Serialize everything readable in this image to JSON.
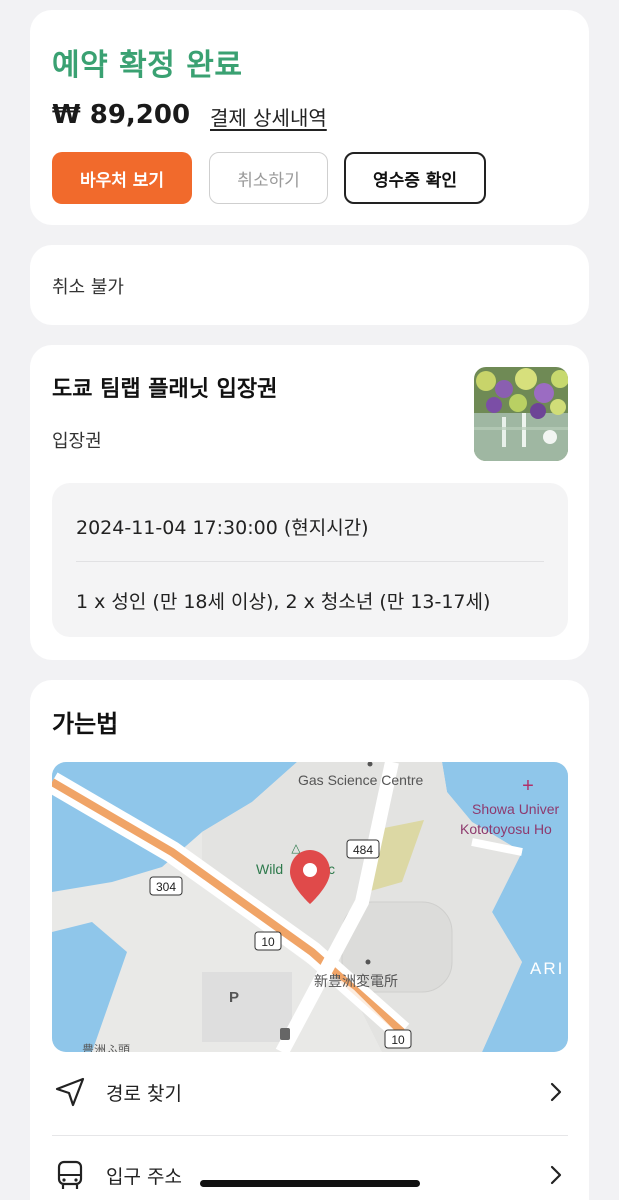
{
  "booking": {
    "status_title": "예약 확정 완료",
    "price": "₩ 89,200",
    "detail_link": "결제 상세내역",
    "buttons": {
      "voucher": "바우처 보기",
      "cancel": "취소하기",
      "receipt": "영수증 확인"
    }
  },
  "cancel_policy": {
    "text": "취소 불가"
  },
  "product": {
    "title": "도쿄 팀랩 플래닛 입장권",
    "subtitle": "입장권",
    "datetime": "2024-11-04 17:30:00 (현지시간)",
    "tickets": "1 x 성인 (만 18세 이상), 2 x 청소년 (만 13-17세)"
  },
  "route": {
    "title": "가는법",
    "map": {
      "labels": {
        "gas_science": "Gas Science Centre",
        "showa": "Showa Univer",
        "kototoyosu": "Kototoyosu Ho",
        "wild": "Wild",
        "wild_tail": "c",
        "substation": "新豊洲変電所",
        "ari": "ARI",
        "toyosu_bottom": "豊洲ふ頭",
        "parking": "P",
        "route_484": "484",
        "route_304": "304",
        "route_10a": "10",
        "route_10b": "10"
      }
    },
    "directions_label": "경로 찾기",
    "address_label": "입구 주소"
  },
  "colors": {
    "accent_green": "#3aa172",
    "accent_orange": "#f16a2c",
    "map_water": "#8fc6ea",
    "map_land": "#e9e9e7"
  }
}
